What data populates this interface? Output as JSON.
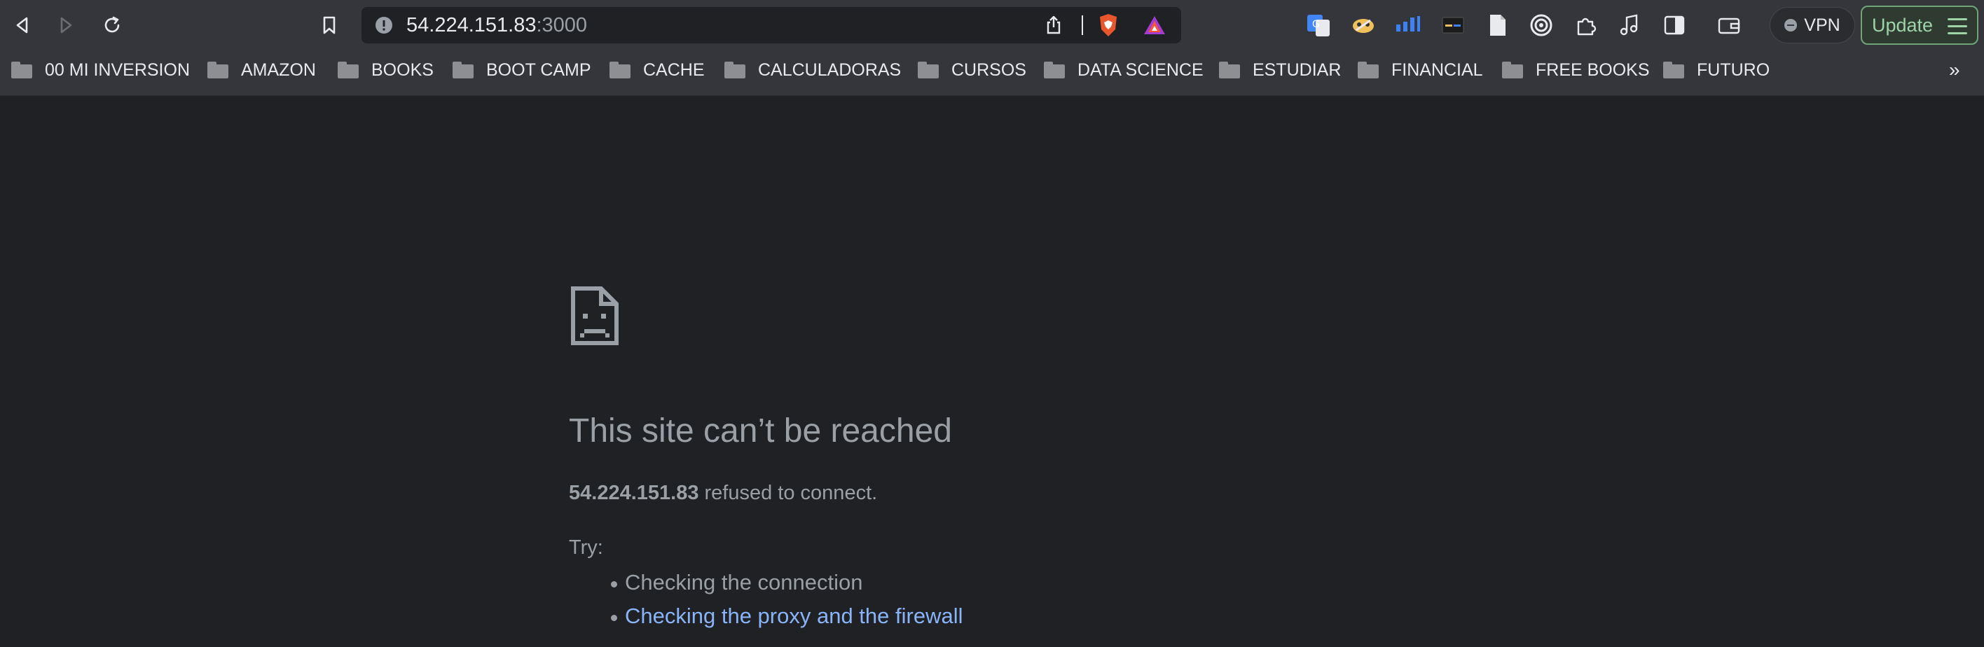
{
  "toolbar": {
    "url_host": "54.224.151.83",
    "url_port": ":3000",
    "vpn_label": "VPN",
    "update_label": "Update"
  },
  "bookmarks": [
    {
      "label": "00 MI INVERSION"
    },
    {
      "label": "AMAZON"
    },
    {
      "label": "BOOKS"
    },
    {
      "label": "BOOT CAMP"
    },
    {
      "label": "CACHE"
    },
    {
      "label": "CALCULADORAS"
    },
    {
      "label": "CURSOS"
    },
    {
      "label": "DATA SCIENCE"
    },
    {
      "label": "ESTUDIAR"
    },
    {
      "label": "FINANCIAL"
    },
    {
      "label": "FREE BOOKS"
    },
    {
      "label": "FUTURO"
    }
  ],
  "bookmarks_overflow": "»",
  "error": {
    "title": "This site can’t be reached",
    "host": "54.224.151.83",
    "message": " refused to connect.",
    "try_label": "Try:",
    "suggestions": [
      {
        "text": "Checking the connection",
        "is_link": false
      },
      {
        "text": "Checking the proxy and the firewall",
        "is_link": true
      }
    ]
  },
  "colors": {
    "page_bg": "#202124",
    "toolbar_bg": "#35363b",
    "link": "#8ab4f8",
    "update_accent": "#9dd3a7"
  }
}
